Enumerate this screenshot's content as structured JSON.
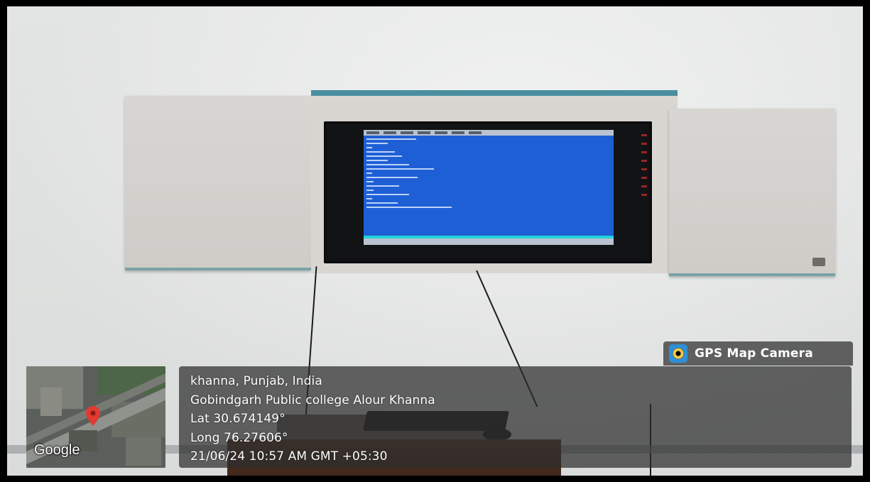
{
  "location": {
    "city_line": "khanna, Punjab, India",
    "place_line": "Gobindgarh Public college Alour Khanna",
    "lat_line": "Lat 30.674149°",
    "long_line": "Long 76.27606°",
    "datetime_line": "21/06/24 10:57 AM GMT +05:30"
  },
  "badge": {
    "label": "GPS Map Camera",
    "icon": "camera-lens-icon"
  },
  "map": {
    "attribution": "Google",
    "pin_icon": "map-pin-icon"
  },
  "colors": {
    "screen": "#1f5fd6",
    "overlay": "#2d2d2d",
    "pin": "#e23a2f"
  }
}
